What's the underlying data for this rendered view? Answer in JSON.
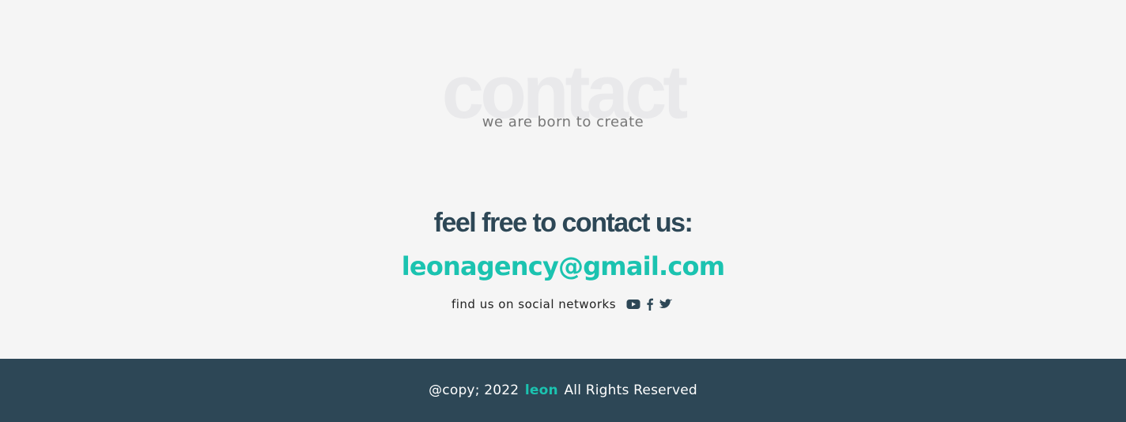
{
  "contact": {
    "background_word": "contact",
    "subtitle": "we are born to create",
    "heading": "feel free to contact us:",
    "email": "leonagency@gmail.com",
    "social_label": "find us on social networks",
    "social_icons": [
      "youtube-icon",
      "facebook-icon",
      "twitter-icon"
    ]
  },
  "footer": {
    "copy_prefix": "@copy; 2022",
    "brand": "leon",
    "copy_suffix": "All Rights Reserved"
  },
  "colors": {
    "background": "#f5f5f5",
    "footer_background": "#2d4756",
    "heading": "#2d4756",
    "accent": "#1bc3b0",
    "watermark": "#e9e9eb",
    "subtitle": "#777777"
  }
}
